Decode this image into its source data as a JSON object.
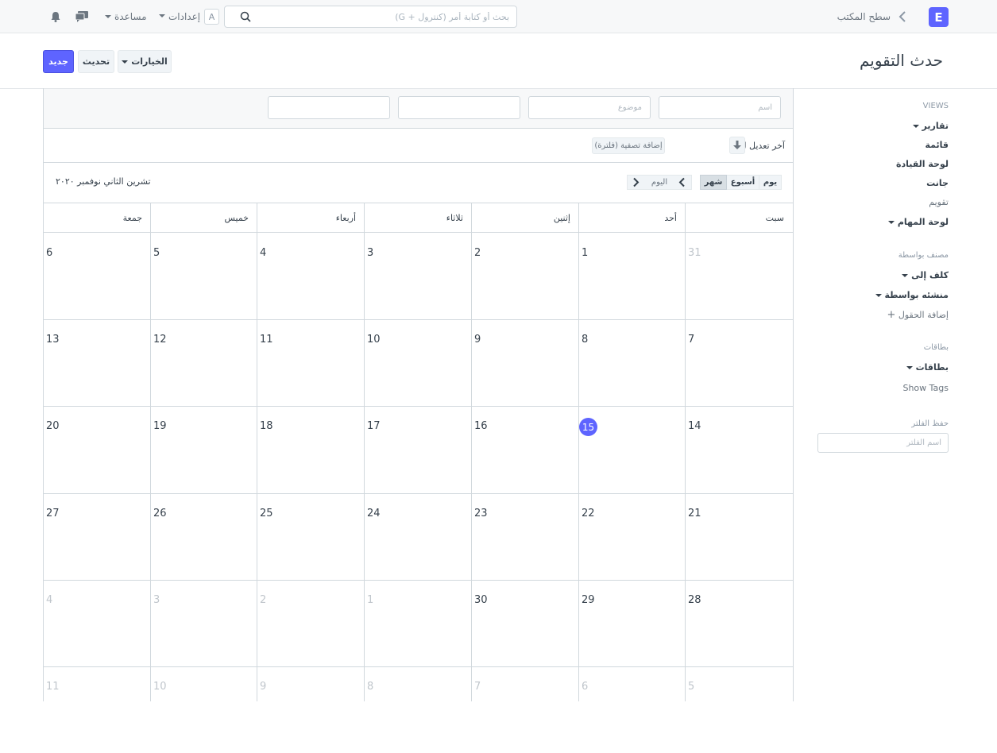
{
  "navbar": {
    "logo_letter": "E",
    "breadcrumb": "سطح المكتب",
    "search_placeholder": "بحث أو كتابة أمر (كنترول + G)",
    "avatar_letter": "A",
    "settings_label": "إعدادات",
    "help_label": "مساعدة"
  },
  "page": {
    "title": "حدث التقويم",
    "new_label": "جديد",
    "refresh_label": "تحديث",
    "options_label": "الخيارات"
  },
  "sidebar": {
    "views_heading": "VIEWS",
    "reports_label": "تقارير",
    "list_label": "قائمة",
    "dashboard_label": "لوحة القيادة",
    "gantt_label": "جانت",
    "calendar_label": "تقويم",
    "kanban_label": "لوحة المهام",
    "classified_heading": "مصنف بواسطة",
    "assigned_label": "كلف إلى",
    "created_label": "منشئه بواسطة",
    "add_fields_label": "إضافة الحقول",
    "tags_heading": "بطاقات",
    "tags_label": "بطاقات",
    "show_tags_label": "Show Tags",
    "save_filter_heading": "حفظ الفلتر",
    "filter_name_placeholder": "اسم الفلتر"
  },
  "filters": {
    "name_placeholder": "اسم",
    "subject_placeholder": "موضوع",
    "field3_placeholder": "",
    "field4_placeholder": "",
    "sort_label": "آخر تعديل ل",
    "add_filter_label": "إضافة تصفية (فلترة)"
  },
  "calendar": {
    "view_day": "يوم",
    "view_week": "أسبوع",
    "view_month": "شهر",
    "today_label": "اليوم",
    "month_title": "تشرين الثاني نوفمبر ٢٠٢٠",
    "today_day": "15",
    "weekdays": [
      "سبت",
      "أحد",
      "إثنين",
      "ثلاثاء",
      "أربعاء",
      "خميس",
      "جمعة"
    ],
    "weeks": [
      [
        "31",
        "1",
        "2",
        "3",
        "4",
        "5",
        "6"
      ],
      [
        "7",
        "8",
        "9",
        "10",
        "11",
        "12",
        "13"
      ],
      [
        "14",
        "15",
        "16",
        "17",
        "18",
        "19",
        "20"
      ],
      [
        "21",
        "22",
        "23",
        "24",
        "25",
        "26",
        "27"
      ],
      [
        "28",
        "29",
        "30",
        "1",
        "2",
        "3",
        "4"
      ],
      [
        "5",
        "6",
        "7",
        "8",
        "9",
        "10",
        "11"
      ]
    ]
  },
  "colors": {
    "accent": "#5e64ff",
    "border": "#d1d8dd",
    "muted_text": "#c0c6cc"
  }
}
